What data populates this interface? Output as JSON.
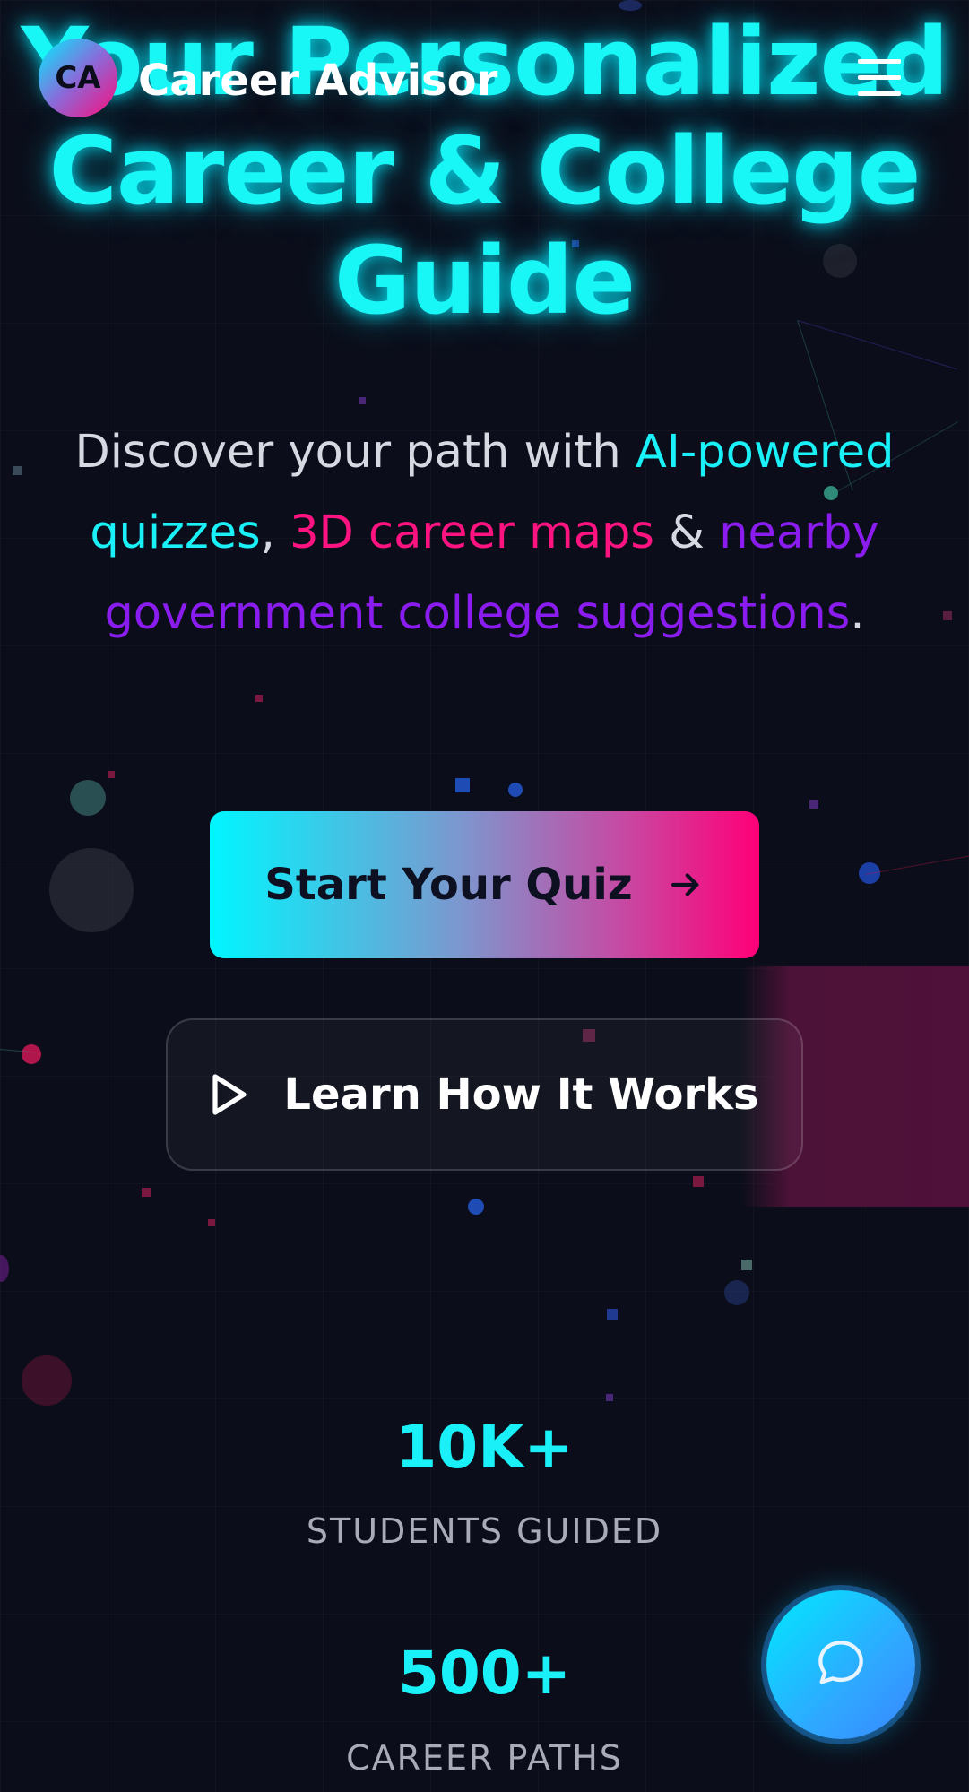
{
  "header": {
    "logo_initials": "CA",
    "brand_name": "Career Advisor",
    "menu_icon": "hamburger-menu-icon"
  },
  "hero": {
    "title": "Your Personalized Career & College Guide",
    "subtitle": {
      "prefix": "Discover your path with ",
      "highlight1": "AI-powered quizzes",
      "sep1": ", ",
      "highlight2": "3D career maps",
      "sep2": " & ",
      "highlight3": "nearby government college suggestions",
      "suffix": "."
    }
  },
  "actions": {
    "primary_label": "Start Your Quiz",
    "primary_icon": "arrow-right-icon",
    "secondary_label": "Learn How It Works",
    "secondary_icon": "play-icon"
  },
  "stats": [
    {
      "value": "10K+",
      "label": "STUDENTS GUIDED"
    },
    {
      "value": "500+",
      "label": "CAREER PATHS"
    }
  ],
  "chat": {
    "icon": "chat-bubble-icon"
  },
  "colors": {
    "background": "#0b0e1a",
    "accent_cyan": "#19f0f8",
    "accent_pink": "#ff1380",
    "accent_purple": "#8a1cf0"
  }
}
